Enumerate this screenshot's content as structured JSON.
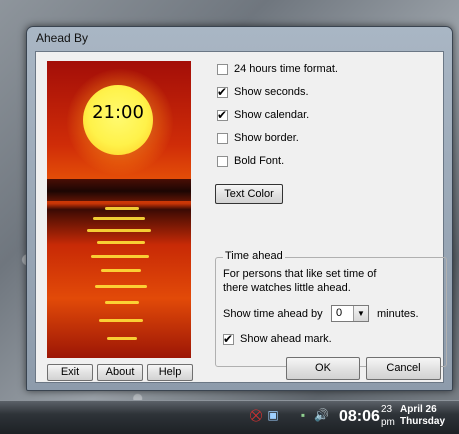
{
  "window": {
    "title": "Ahead By"
  },
  "clock_preview": {
    "time": "21:00"
  },
  "left_buttons": {
    "exit": "Exit",
    "about": "About",
    "help": "Help"
  },
  "options": [
    {
      "label": "24 hours time format.",
      "checked": false
    },
    {
      "label": "Show seconds.",
      "checked": true
    },
    {
      "label": "Show calendar.",
      "checked": true
    },
    {
      "label": "Show border.",
      "checked": false
    },
    {
      "label": "Bold Font.",
      "checked": false
    }
  ],
  "text_color_button": "Text Color",
  "time_ahead": {
    "group_title": "Time ahead",
    "description_line1": "For persons that like set time of",
    "description_line2": "there watches little ahead.",
    "show_ahead_label": "Show time ahead by",
    "minutes_value": "0",
    "minutes_label": "minutes.",
    "show_mark_label": "Show ahead mark.",
    "show_mark_checked": true
  },
  "dialog_buttons": {
    "ok": "OK",
    "cancel": "Cancel"
  },
  "taskbar": {
    "clock_time": "08:06",
    "clock_seconds": "23",
    "clock_ampm": "pm",
    "date": "April 26",
    "weekday": "Thursday"
  },
  "tray_icons": [
    "security-alert-icon",
    "network-icon",
    "speaker-icon"
  ]
}
